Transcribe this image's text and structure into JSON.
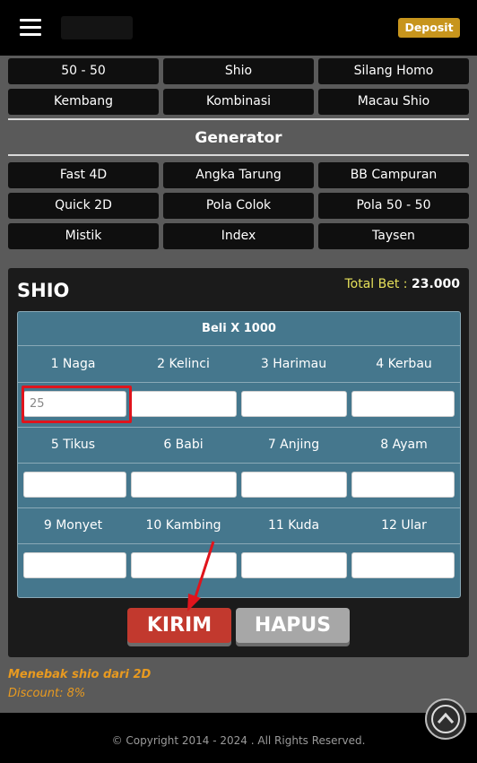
{
  "header": {
    "deposit_label": "Deposit"
  },
  "menu": {
    "row1": [
      "50 - 50",
      "Shio",
      "Silang Homo"
    ],
    "row2": [
      "Kembang",
      "Kombinasi",
      "Macau Shio"
    ]
  },
  "generator": {
    "title": "Generator",
    "row1": [
      "Fast 4D",
      "Angka Tarung",
      "BB Campuran"
    ],
    "row2": [
      "Quick 2D",
      "Pola Colok",
      "Pola 50 - 50"
    ],
    "row3": [
      "Mistik",
      "Index",
      "Taysen"
    ]
  },
  "panel": {
    "title": "SHIO",
    "total_label": "Total Bet :",
    "total_value": "23.000",
    "grid_header": "Beli X 1000",
    "labels_row1": [
      "1 Naga",
      "2 Kelinci",
      "3 Harimau",
      "4 Kerbau"
    ],
    "labels_row2": [
      "5 Tikus",
      "6 Babi",
      "7 Anjing",
      "8 Ayam"
    ],
    "labels_row3": [
      "9 Monyet",
      "10 Kambing",
      "11 Kuda",
      "12 Ular"
    ],
    "input_naga_value": "25",
    "kirim_label": "KIRIM",
    "hapus_label": "HAPUS"
  },
  "notes": {
    "line1": "Menebak shio dari 2D",
    "line2": "Discount: 8%"
  },
  "footer": {
    "copyright": "© Copyright 2014 - 2024 . All Rights Reserved."
  },
  "colors": {
    "accent_red": "#c2392e",
    "deposit_gold": "#c7951d",
    "grid_blue": "#45778d",
    "note_orange": "#e89a20",
    "total_yellow": "#e6e05a"
  },
  "icons": [
    "hamburger-icon",
    "chevron-up-icon",
    "red-arrow-annotation"
  ]
}
